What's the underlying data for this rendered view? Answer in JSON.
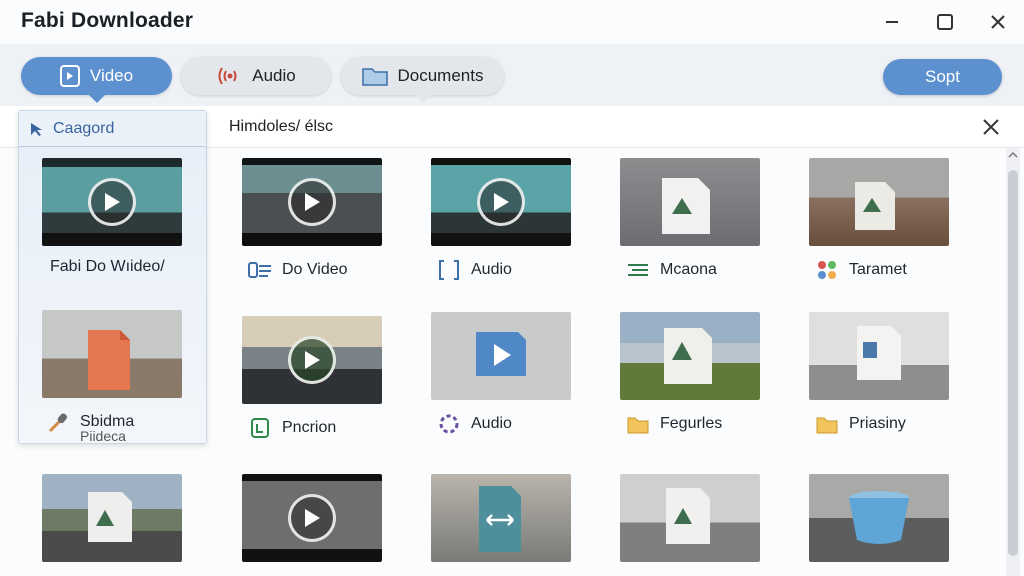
{
  "window": {
    "title": "Fabi Downloader"
  },
  "tabs": [
    {
      "label": "Video",
      "icon": "video-file-icon",
      "active": true
    },
    {
      "label": "Audio",
      "icon": "audio-wave-icon",
      "active": false
    },
    {
      "label": "Documents",
      "icon": "folder-icon",
      "active": false
    }
  ],
  "toolbar": {
    "sort_label": "Sopt"
  },
  "path": {
    "text": "Himdoles/ élsc"
  },
  "category": {
    "title": "Caagord"
  },
  "items": [
    {
      "label": "Fabi Do Wıideo/",
      "icon": "none",
      "thumb": "video-teal"
    },
    {
      "label": "Do Video",
      "icon": "video-list-icon",
      "thumb": "video-office"
    },
    {
      "label": "Audio",
      "icon": "audio-bracket-icon",
      "thumb": "video-teal"
    },
    {
      "label": "Mcaona",
      "icon": "list-icon",
      "thumb": "doc-room"
    },
    {
      "label": "Taramet",
      "icon": "puzzle-icon",
      "thumb": "doc-floor"
    },
    {
      "label": "Sbidma",
      "sublabel": "Piideca",
      "icon": "microphone-icon",
      "thumb": "doc-orange"
    },
    {
      "label": "Pncrion",
      "icon": "document-green-icon",
      "thumb": "video-mountain"
    },
    {
      "label": "Audio",
      "icon": "audio-ring-icon",
      "thumb": "video-blue-file"
    },
    {
      "label": "Fegurles",
      "icon": "folder-icon",
      "thumb": "doc-mountain"
    },
    {
      "label": "Priasiny",
      "icon": "folder-icon",
      "thumb": "doc-office"
    },
    {
      "label": "",
      "icon": "none",
      "thumb": "doc-road"
    },
    {
      "label": "",
      "icon": "none",
      "thumb": "video-dark"
    },
    {
      "label": "",
      "icon": "none",
      "thumb": "swap-file"
    },
    {
      "label": "",
      "icon": "none",
      "thumb": "doc-hall"
    },
    {
      "label": "",
      "icon": "none",
      "thumb": "bucket-room"
    }
  ],
  "colors": {
    "accent": "#5d90cf",
    "panel": "#e6eef8",
    "tabbar": "#eef1f5"
  }
}
